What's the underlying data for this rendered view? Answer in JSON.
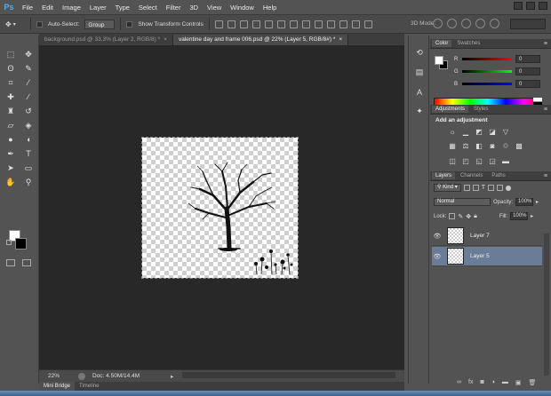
{
  "app": {
    "logo": "Ps",
    "menu": [
      "File",
      "Edit",
      "Image",
      "Layer",
      "Type",
      "Select",
      "Filter",
      "3D",
      "View",
      "Window",
      "Help"
    ]
  },
  "options": {
    "auto_select_label": "Auto-Select:",
    "auto_select_value": "Group",
    "transform_label": "Show Transform Controls",
    "mode3d_label": "3D Mode:"
  },
  "tabs": [
    {
      "label": "background.psd @ 33.3% (Layer 2, RGB/8) *",
      "active": false
    },
    {
      "label": "valentine day and frame 006.psd @ 22% (Layer 5, RGB/8#) *",
      "active": true
    }
  ],
  "status": {
    "zoom": "22%",
    "doc": "Doc: 4.50M/14.4M"
  },
  "bottom_tabs": [
    "Mini Bridge",
    "Timeline"
  ],
  "color_panel": {
    "tabs": [
      "Color",
      "Swatches"
    ],
    "sliders": [
      {
        "label": "R",
        "value": "0",
        "gradient": "linear-gradient(90deg,#000,#f00)"
      },
      {
        "label": "G",
        "value": "0",
        "gradient": "linear-gradient(90deg,#000,#0f0)"
      },
      {
        "label": "B",
        "value": "0",
        "gradient": "linear-gradient(90deg,#000,#00f)"
      }
    ]
  },
  "adjustments": {
    "tabs": [
      "Adjustments",
      "Styles"
    ],
    "title": "Add an adjustment"
  },
  "layers": {
    "tabs": [
      "Layers",
      "Channels",
      "Paths"
    ],
    "kind": "Kind",
    "blend_mode": "Normal",
    "opacity_label": "Opacity:",
    "opacity_value": "100%",
    "lock_label": "Lock:",
    "fill_label": "Fill:",
    "fill_value": "100%",
    "items": [
      {
        "name": "Layer 7",
        "selected": false
      },
      {
        "name": "Layer 5",
        "selected": true
      }
    ]
  },
  "colors": {
    "accent_selected": "#6b7d96",
    "ps_blue": "#4fb0f0"
  }
}
